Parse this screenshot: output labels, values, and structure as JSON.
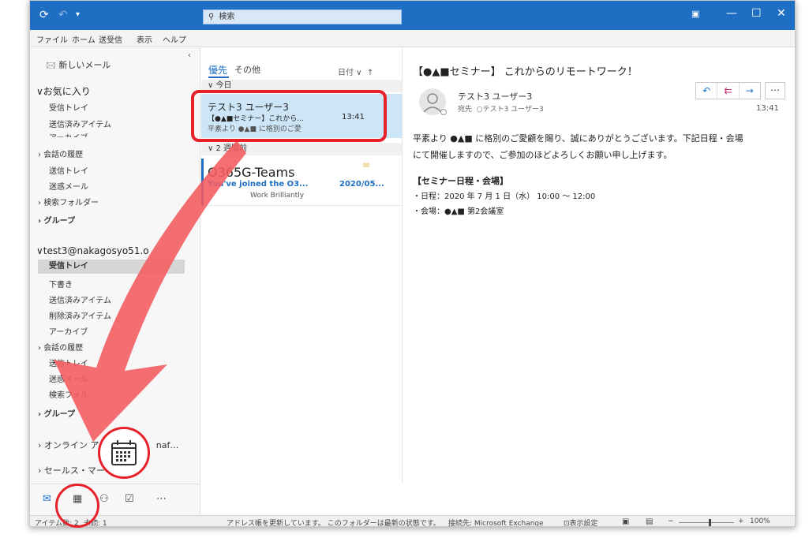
{
  "titlebar": {
    "search_placeholder": "検索"
  },
  "menu": [
    "ファイル",
    "ホーム",
    "送受信",
    "表示",
    "ヘルプ"
  ],
  "folder_pane": {
    "new_mail": "新しいメール",
    "favorites_header": "お気に入り",
    "favorites": [
      "受信トレイ",
      "送信済みアイテム",
      "アーカイブ",
      "会話の履歴",
      "送信トレイ",
      "迷惑メール",
      "検索フォルダー"
    ],
    "group_label_1": "グループ",
    "account": "test3@nakagosyo51.o",
    "account_folders": [
      "受信トレイ",
      "下書き",
      "送信済みアイテム",
      "削除済みアイテム",
      "アーカイブ",
      "会話の履歴",
      "送信トレイ",
      "迷惑メール",
      "検索フォル"
    ],
    "group_label_2": "グループ",
    "online_archive": "オンライン アー",
    "online_archive_suffix": "naf…",
    "sales": "セールス・マー"
  },
  "mail_list": {
    "tab_focused": "優先",
    "tab_other": "その他",
    "sort_label": "日付",
    "group_today": "今日",
    "group_two_weeks": "2 週間前",
    "mail1": {
      "sender": "テスト3 ユーザー3",
      "subject": "【●▲■セミナー】これから...",
      "time": "13:41",
      "preview": "平素より ●▲■ に格別のご愛"
    },
    "mail2": {
      "sender": "O365G-Teams",
      "subject": "You've joined the O3...",
      "date": "2020/05...",
      "preview": "Work Brilliantly"
    }
  },
  "reading_pane": {
    "title": "【●▲■セミナー】 これからのリモートワーク！",
    "sender": "テスト3 ユーザー3",
    "to_label": "宛先",
    "to": "テスト3 ユーザー3",
    "time": "13:41",
    "body": [
      "平素より ●▲■ に格別のご愛顧を賜り、誠にありがとうございます。下記日程・会場",
      "にて開催しますので、ご参加のほどよろしくお願い申し上げます。",
      "【セミナー日程・会場】",
      "・日程：2020 年 7 月 1 日（水） 10:00 〜 12:00",
      "・会場：●▲■ 第2会議室"
    ]
  },
  "statusbar": {
    "items_label": "アイテム数: 2",
    "unread_label": "未読: 1",
    "message": "アドレス帳を更新しています。 このフォルダーは最新の状態です。",
    "connection": "接続先: Microsoft Exchange",
    "display_settings": "表示設定",
    "zoom": "100%"
  },
  "colors": {
    "accent": "#1e6fc4",
    "annotation": "#e8202a",
    "selected_mail": "#cde6f7"
  }
}
